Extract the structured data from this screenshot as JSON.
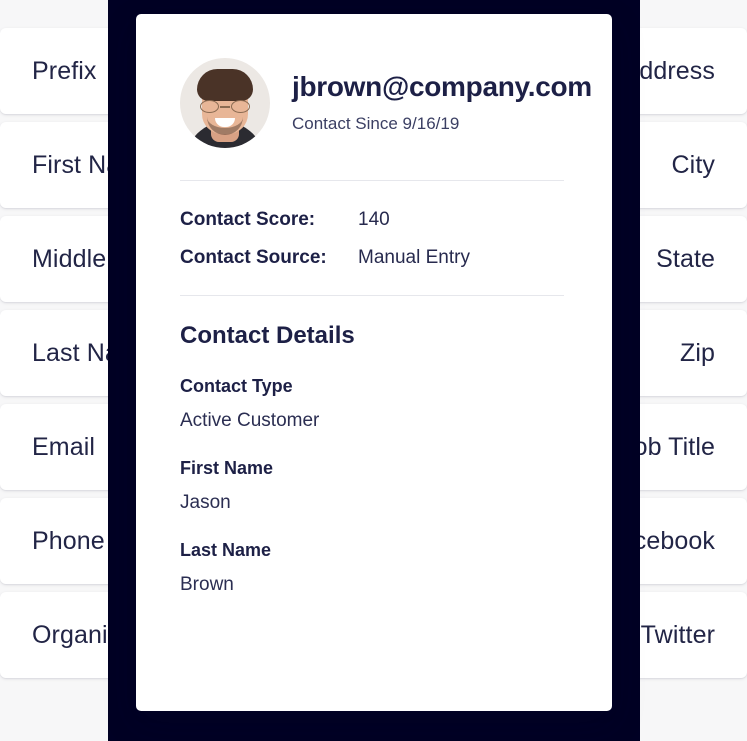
{
  "background_form": {
    "rows": [
      {
        "left_label": "Prefix",
        "right_label": "Address"
      },
      {
        "left_label": "First Name",
        "right_label": "City"
      },
      {
        "left_label": "Middle Name",
        "right_label": "State"
      },
      {
        "left_label": "Last Name",
        "right_label": "Zip"
      },
      {
        "left_label": "Email",
        "right_label": "Job Title"
      },
      {
        "left_label": "Phone",
        "right_label": "Facebook"
      },
      {
        "left_label": "Organization",
        "right_label": "Twitter"
      }
    ]
  },
  "card": {
    "avatar_alt": "contact-photo",
    "email": "jbrown@company.com",
    "contact_since": "Contact Since 9/16/19",
    "summary": [
      {
        "key": "Contact Score:",
        "value": "140"
      },
      {
        "key": "Contact Source:",
        "value": "Manual Entry"
      }
    ],
    "details_title": "Contact Details",
    "details": [
      {
        "label": "Contact Type",
        "value": "Active Customer"
      },
      {
        "label": "First Name",
        "value": "Jason"
      },
      {
        "label": "Last Name",
        "value": "Brown"
      }
    ]
  },
  "colors": {
    "panel_navy": "#000024",
    "text_navy": "#1d2046",
    "page_bg": "#f7f7f8",
    "card_bg": "#ffffff",
    "divider": "#e6e7ec"
  }
}
